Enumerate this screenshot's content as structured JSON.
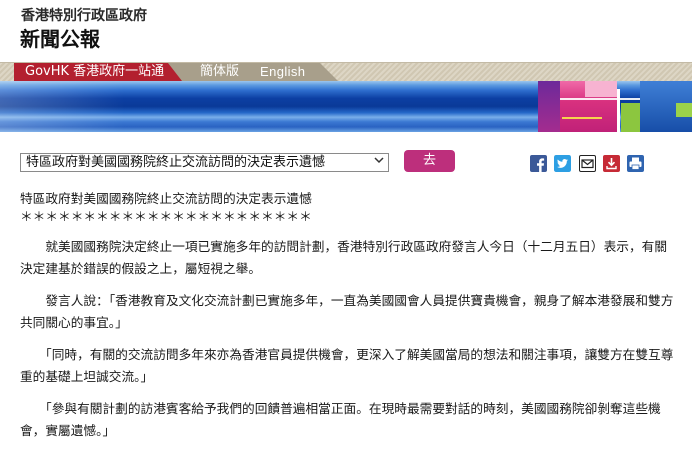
{
  "header": {
    "org_name": "香港特別行政區政府",
    "section_title": "新聞公報"
  },
  "nav": {
    "govhk_label": "GovHK 香港政府一站通",
    "simplified_label": "簡体版",
    "english_label": "English"
  },
  "toolbar": {
    "selected_release": "特區政府對美國國務院終止交流訪問的決定表示遺憾",
    "go_label": "去"
  },
  "release": {
    "title": "特區政府對美國國務院終止交流訪問的決定表示遺憾",
    "separator": "＊＊＊＊＊＊＊＊＊＊＊＊＊＊＊＊＊＊＊＊＊＊＊",
    "paragraphs": [
      "　　就美國國務院決定終止一項已實施多年的訪問計劃，香港特別行政區政府發言人今日（十二月五日）表示，有關決定建基於錯誤的假設之上，屬短視之舉。",
      "　　發言人說：「香港教育及文化交流計劃已實施多年，一直為美國國會人員提供寶貴機會，親身了解本港發展和雙方共同關心的事宜。」",
      "　　「同時，有關的交流訪問多年來亦為香港官員提供機會，更深入了解美國當局的想法和關注事項，讓雙方在雙互尊重的基礎上坦誠交流。」",
      "　　「參與有關計劃的訪港賓客給予我們的回饋普遍相當正面。在現時最需要對話的時刻，美國國務院卻剝奪這些機會，實屬遺憾。」"
    ]
  },
  "icons": {
    "select_arrow": "chevron-down-icon",
    "share": [
      "facebook-icon",
      "twitter-icon",
      "email-icon",
      "download-icon",
      "print-icon"
    ]
  },
  "colors": {
    "govhk_red": "#b3202f",
    "language_tab": "#a89f8b",
    "nav_background": "#ddd6c5",
    "banner_blue": "#0c3fa3",
    "go_button": "#bd2f7c",
    "text": "#1a1a1a"
  }
}
